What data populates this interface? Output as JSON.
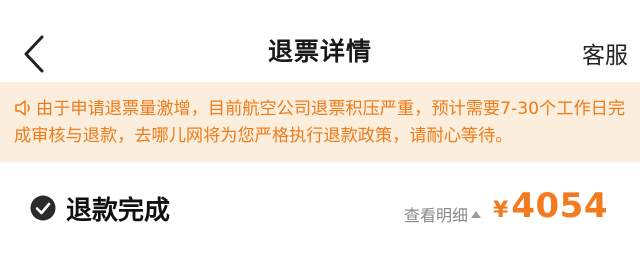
{
  "header": {
    "title": "退票详情",
    "service_label": "客服",
    "back_icon": "chevron-left-icon"
  },
  "notice": {
    "icon": "speaker-icon",
    "text": "由于申请退票量激增，目前航空公司退票积压严重，预计需要7-30个工作日完成审核与退款，去哪儿网将为您严格执行退款政策，请耐心等待。"
  },
  "refund": {
    "status_icon": "check-circle-icon",
    "status_text": "退款完成",
    "detail_label": "查看明细",
    "currency": "¥",
    "amount": "4054"
  },
  "colors": {
    "accent": "#f47a1f",
    "notice_bg": "#fbeedd",
    "notice_text": "#f07b1a"
  }
}
